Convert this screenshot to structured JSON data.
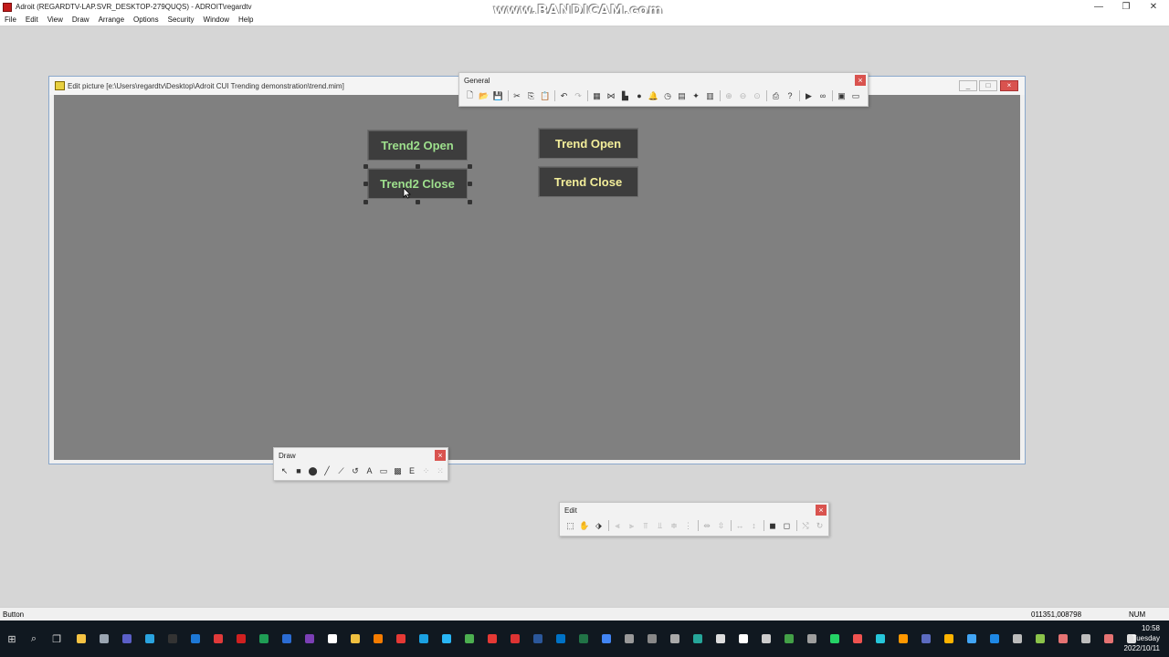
{
  "window": {
    "title": "Adroit (REGARDTV-LAP.SVR_DESKTOP-279QUQS) - ADROIT\\regardtv",
    "watermark": "www.BANDICAM.com",
    "minimize": "—",
    "restore": "❐",
    "close": "✕"
  },
  "menu": [
    "File",
    "Edit",
    "View",
    "Draw",
    "Arrange",
    "Options",
    "Security",
    "Window",
    "Help"
  ],
  "picture_window": {
    "title": "Edit picture [e:\\Users\\regardtv\\Desktop\\Adroit CUI Trending demonstration\\trend.mim]",
    "min": "_",
    "max": "□",
    "close": "×"
  },
  "buttons": {
    "trend2_open": "Trend2 Open",
    "trend2_close": "Trend2 Close",
    "trend_open": "Trend Open",
    "trend_close": "Trend Close",
    "green_color": "#9ee08d",
    "yellow_color": "#f3ee9a"
  },
  "general_toolbar": {
    "title": "General",
    "close": "×",
    "tools": [
      {
        "name": "new-icon",
        "glyph": "🗋"
      },
      {
        "name": "open-icon",
        "glyph": "📂"
      },
      {
        "name": "save-icon",
        "glyph": "💾"
      },
      {
        "name": "sep"
      },
      {
        "name": "cut-icon",
        "glyph": "✂"
      },
      {
        "name": "copy-icon",
        "glyph": "⎘"
      },
      {
        "name": "paste-icon",
        "glyph": "📋"
      },
      {
        "name": "sep"
      },
      {
        "name": "undo-icon",
        "glyph": "↶"
      },
      {
        "name": "redo-icon",
        "glyph": "↷",
        "disabled": true
      },
      {
        "name": "sep"
      },
      {
        "name": "grid-icon",
        "glyph": "▦"
      },
      {
        "name": "trend-icon",
        "glyph": "⋈"
      },
      {
        "name": "chart-icon",
        "glyph": "▙"
      },
      {
        "name": "globe-icon",
        "glyph": "●"
      },
      {
        "name": "bell-icon",
        "glyph": "🔔"
      },
      {
        "name": "clock-icon",
        "glyph": "◷"
      },
      {
        "name": "database-icon",
        "glyph": "▤"
      },
      {
        "name": "wand-icon",
        "glyph": "✦"
      },
      {
        "name": "table-icon",
        "glyph": "▥"
      },
      {
        "name": "sep"
      },
      {
        "name": "zoom-in-icon",
        "glyph": "⊕",
        "disabled": true
      },
      {
        "name": "zoom-out-icon",
        "glyph": "⊖",
        "disabled": true
      },
      {
        "name": "zoom-fit-icon",
        "glyph": "⊙",
        "disabled": true
      },
      {
        "name": "sep"
      },
      {
        "name": "print-icon",
        "glyph": "⎙"
      },
      {
        "name": "help-icon",
        "glyph": "?"
      },
      {
        "name": "sep"
      },
      {
        "name": "run-icon",
        "glyph": "▶"
      },
      {
        "name": "link-icon",
        "glyph": "∞"
      },
      {
        "name": "sep"
      },
      {
        "name": "properties-icon",
        "glyph": "▣"
      },
      {
        "name": "window-icon",
        "glyph": "▭"
      }
    ]
  },
  "draw_toolbar": {
    "title": "Draw",
    "close": "×",
    "tools": [
      {
        "name": "pointer-icon",
        "glyph": "↖"
      },
      {
        "name": "rectangle-icon",
        "glyph": "■"
      },
      {
        "name": "ellipse-icon",
        "glyph": "⬤"
      },
      {
        "name": "line-icon",
        "glyph": "╱"
      },
      {
        "name": "polyline-icon",
        "glyph": "⟋"
      },
      {
        "name": "arc-icon",
        "glyph": "↺"
      },
      {
        "name": "text-icon",
        "glyph": "A"
      },
      {
        "name": "button-icon",
        "glyph": "▭"
      },
      {
        "name": "image-icon",
        "glyph": "▩"
      },
      {
        "name": "embed-icon",
        "glyph": "E"
      },
      {
        "name": "group-icon",
        "glyph": "⁘",
        "disabled": true
      },
      {
        "name": "ungroup-icon",
        "glyph": "⁙",
        "disabled": true
      }
    ]
  },
  "edit_toolbar": {
    "title": "Edit",
    "close": "×",
    "tools": [
      {
        "name": "edit-select-icon",
        "glyph": "⬚"
      },
      {
        "name": "edit-hand-icon",
        "glyph": "✋"
      },
      {
        "name": "edit-tag-icon",
        "glyph": "⬗"
      },
      {
        "name": "sep"
      },
      {
        "name": "align-left-icon",
        "glyph": "⫷",
        "disabled": true
      },
      {
        "name": "align-right-icon",
        "glyph": "⫸",
        "disabled": true
      },
      {
        "name": "align-top-icon",
        "glyph": "⫪",
        "disabled": true
      },
      {
        "name": "align-bottom-icon",
        "glyph": "⫫",
        "disabled": true
      },
      {
        "name": "align-center-v-icon",
        "glyph": "≑",
        "disabled": true
      },
      {
        "name": "align-center-h-icon",
        "glyph": "⋮",
        "disabled": true
      },
      {
        "name": "sep"
      },
      {
        "name": "space-h-icon",
        "glyph": "⇹",
        "disabled": true
      },
      {
        "name": "space-v-icon",
        "glyph": "⇳",
        "disabled": true
      },
      {
        "name": "sep"
      },
      {
        "name": "size-width-icon",
        "glyph": "↔",
        "disabled": true
      },
      {
        "name": "size-height-icon",
        "glyph": "↕",
        "disabled": true
      },
      {
        "name": "sep"
      },
      {
        "name": "bring-front-icon",
        "glyph": "◼"
      },
      {
        "name": "send-back-icon",
        "glyph": "◻"
      },
      {
        "name": "sep"
      },
      {
        "name": "flip-icon",
        "glyph": "⤭",
        "disabled": true
      },
      {
        "name": "rotate-icon",
        "glyph": "↻",
        "disabled": true
      }
    ]
  },
  "status": {
    "left": "Button",
    "coords": "011351,008798",
    "num": "NUM"
  },
  "taskbar": {
    "start": "⊞",
    "search": "⌕",
    "taskview": "❐",
    "apps": [
      {
        "name": "file-explorer-icon",
        "color": "#f6c343"
      },
      {
        "name": "gear-app-icon",
        "color": "#9aa5b1"
      },
      {
        "name": "teams-icon",
        "color": "#5b5fc7"
      },
      {
        "name": "telegram-icon",
        "color": "#2aa3df"
      },
      {
        "name": "terminal-icon",
        "color": "#333333"
      },
      {
        "name": "remote-desktop-icon",
        "color": "#1d78d6"
      },
      {
        "name": "pdf-icon",
        "color": "#e03a3a"
      },
      {
        "name": "adroit-icon",
        "color": "#d02020"
      },
      {
        "name": "sheet-app-icon",
        "color": "#1f9d55"
      },
      {
        "name": "word-app-icon",
        "color": "#2b6cd3"
      },
      {
        "name": "onenote-icon",
        "color": "#7b3fb5"
      },
      {
        "name": "mail-icon",
        "color": "#ffffff"
      },
      {
        "name": "folder-icon",
        "color": "#f0c040"
      },
      {
        "name": "search-app-icon",
        "color": "#f57c00"
      },
      {
        "name": "opera-icon",
        "color": "#e53935"
      },
      {
        "name": "edge-icon",
        "color": "#1ba1e2"
      },
      {
        "name": "photo-icon",
        "color": "#29b6f6"
      },
      {
        "name": "chart-app-icon",
        "color": "#4caf50"
      },
      {
        "name": "shield-icon",
        "color": "#e53935"
      },
      {
        "name": "tools-icon",
        "color": "#d33"
      },
      {
        "name": "word-icon",
        "color": "#2b579a"
      },
      {
        "name": "outlook-icon",
        "color": "#0072c6"
      },
      {
        "name": "excel-icon",
        "color": "#217346"
      },
      {
        "name": "chrome-icon",
        "color": "#4285f4"
      },
      {
        "name": "sync-icon",
        "color": "#999999"
      },
      {
        "name": "globe-app-icon",
        "color": "#888888"
      },
      {
        "name": "browser-icon",
        "color": "#aaaaaa"
      },
      {
        "name": "notes-icon",
        "color": "#26a69a"
      },
      {
        "name": "monitor-icon",
        "color": "#dddddd"
      },
      {
        "name": "video-icon",
        "color": "#ffffff"
      },
      {
        "name": "cloud-icon",
        "color": "#cccccc"
      },
      {
        "name": "board-icon",
        "color": "#43a047"
      },
      {
        "name": "chat-icon",
        "color": "#9e9e9e"
      },
      {
        "name": "whatsapp-icon",
        "color": "#25d366"
      },
      {
        "name": "record-icon",
        "color": "#ef5350"
      },
      {
        "name": "network-icon",
        "color": "#26c6da"
      },
      {
        "name": "arrows-icon",
        "color": "#ff9800"
      },
      {
        "name": "vs-icon",
        "color": "#5c6bc0"
      },
      {
        "name": "box-icon",
        "color": "#ffb300"
      },
      {
        "name": "screen-icon",
        "color": "#42a5f5"
      },
      {
        "name": "window-app-icon",
        "color": "#1e88e5"
      },
      {
        "name": "pen-icon",
        "color": "#bbbbbb"
      },
      {
        "name": "check-icon",
        "color": "#8bc34a"
      },
      {
        "name": "slides-icon",
        "color": "#e57373"
      },
      {
        "name": "camera-icon",
        "color": "#bdbdbd"
      },
      {
        "name": "adroit-task-icon",
        "color": "#e57373"
      },
      {
        "name": "bandicam-icon",
        "color": "#e0e0e0"
      }
    ],
    "time": "10:58",
    "day": "Tuesday",
    "date": "2022/10/11"
  }
}
